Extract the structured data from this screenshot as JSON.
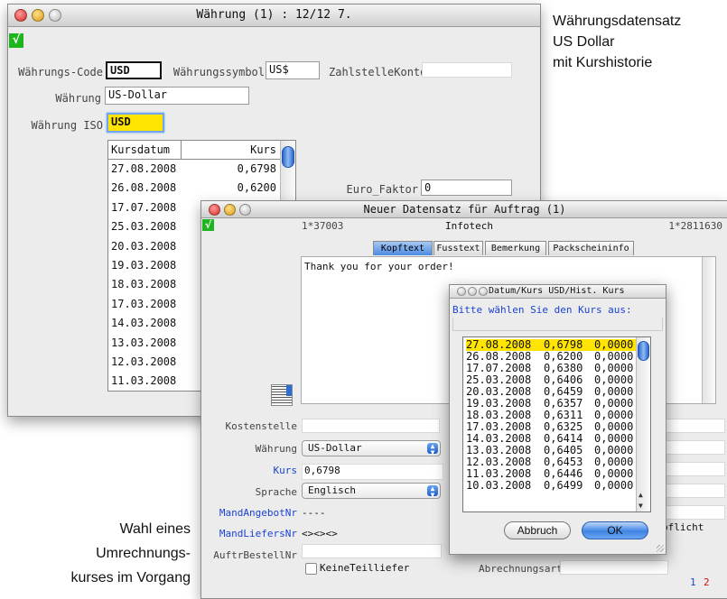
{
  "annotations": {
    "top_right": [
      "Währungsdatensatz",
      "US Dollar",
      "mit Kurshistorie"
    ],
    "bottom_left": [
      "Wahl eines",
      "Umrechnungs-",
      "kurses im Vorgang"
    ]
  },
  "currency_window": {
    "title": "Währung (1) : 12/12 7.",
    "check_mark": "√",
    "labels": {
      "code": "Währungs-Code",
      "symbol": "Währungssymbol",
      "zahlstelle": "ZahlstelleKonto",
      "name": "Währung",
      "iso": "Währung ISO",
      "euro_faktor": "Euro_Faktor"
    },
    "values": {
      "code": "USD",
      "symbol": "US$",
      "zahlstelle": "",
      "name": "US-Dollar",
      "iso": "USD",
      "euro_faktor": "0"
    },
    "table": {
      "headers": [
        "Kursdatum",
        "Kurs"
      ],
      "rows": [
        [
          "27.08.2008",
          "0,6798"
        ],
        [
          "26.08.2008",
          "0,6200"
        ],
        [
          "17.07.2008",
          ""
        ],
        [
          "25.03.2008",
          ""
        ],
        [
          "20.03.2008",
          ""
        ],
        [
          "19.03.2008",
          ""
        ],
        [
          "18.03.2008",
          ""
        ],
        [
          "17.03.2008",
          ""
        ],
        [
          "14.03.2008",
          ""
        ],
        [
          "13.03.2008",
          ""
        ],
        [
          "12.03.2008",
          ""
        ],
        [
          "11.03.2008",
          ""
        ]
      ]
    }
  },
  "order_window": {
    "title": "Neuer Datensatz für Auftrag (1)",
    "check_mark": "√",
    "header": {
      "left_number": "1*37003",
      "customer": "Infotech",
      "right_number": "1*2811630"
    },
    "tabs": [
      "Kopftext",
      "Fusstext",
      "Bemerkung",
      "Packscheininfo"
    ],
    "active_tab": "Kopftext",
    "text_content": "Thank you for your order!",
    "labels": {
      "kostenstelle": "Kostenstelle",
      "waehrung": "Währung",
      "kurs": "Kurs",
      "sprache": "Sprache",
      "mand_angebot": "MandAngebotNr",
      "mand_liefers": "MandLiefersNr",
      "auftr_bestell": "AuftrBestellNr",
      "keine_teillief": "KeineTeilliefer",
      "abrechnungsart": "Abrechnungsart",
      "pflicht_partial": "pflicht"
    },
    "values": {
      "kostenstelle": "",
      "waehrung": "US-Dollar",
      "kurs": "0,6798",
      "sprache": "Englisch",
      "mand_angebot": "----",
      "mand_liefers": "<><><>",
      "auftr_bestell": "",
      "abrechnungsart": ""
    },
    "page_numbers": [
      "1",
      "2"
    ]
  },
  "dialog": {
    "title": "Datum/Kurs USD/Hist. Kurs",
    "prompt": "Bitte wählen Sie den Kurs aus:",
    "rows": [
      [
        "27.08.2008",
        "0,6798",
        "0,0000"
      ],
      [
        "26.08.2008",
        "0,6200",
        "0,0000"
      ],
      [
        "17.07.2008",
        "0,6380",
        "0,0000"
      ],
      [
        "25.03.2008",
        "0,6406",
        "0,0000"
      ],
      [
        "20.03.2008",
        "0,6459",
        "0,0000"
      ],
      [
        "19.03.2008",
        "0,6357",
        "0,0000"
      ],
      [
        "18.03.2008",
        "0,6311",
        "0,0000"
      ],
      [
        "17.03.2008",
        "0,6325",
        "0,0000"
      ],
      [
        "14.03.2008",
        "0,6414",
        "0,0000"
      ],
      [
        "13.03.2008",
        "0,6405",
        "0,0000"
      ],
      [
        "12.03.2008",
        "0,6453",
        "0,0000"
      ],
      [
        "11.03.2008",
        "0,6446",
        "0,0000"
      ],
      [
        "10.03.2008",
        "0,6499",
        "0,0000"
      ]
    ],
    "selected_index": 0,
    "cancel": "Abbruch",
    "ok": "OK"
  },
  "colors": {
    "highlight": "#ffe400",
    "accent_blue": "#1a43d6",
    "check_green": "#1fb51f",
    "page_red": "#d01010"
  }
}
